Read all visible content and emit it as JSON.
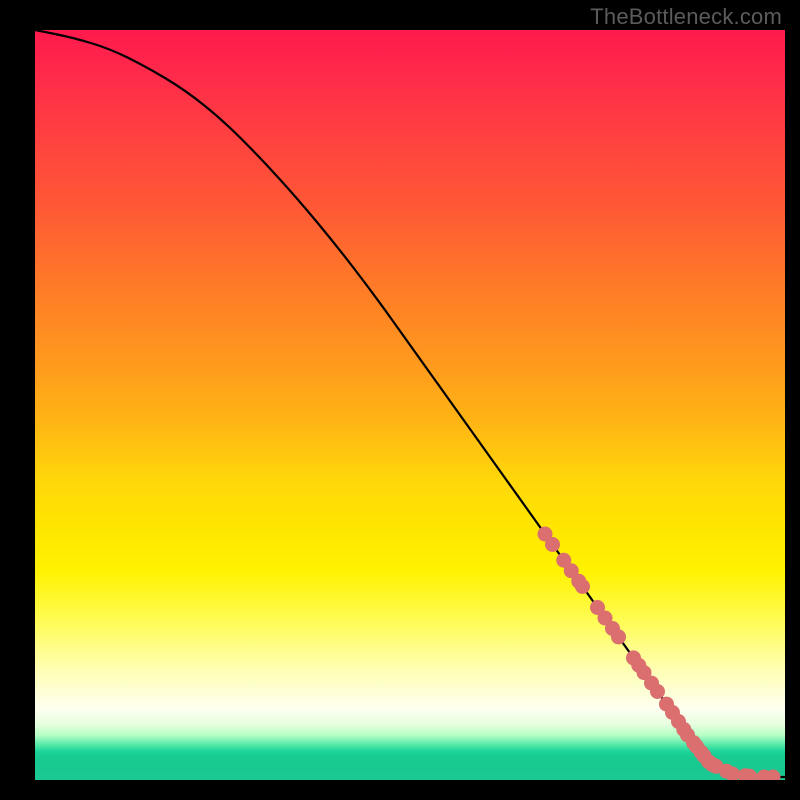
{
  "watermark": "TheBottleneck.com",
  "colors": {
    "page_bg": "#000000",
    "curve_stroke": "#000000",
    "dot_fill": "#db6e6e",
    "watermark_text": "#5b5b5b"
  },
  "chart_data": {
    "type": "line",
    "title": "",
    "xlabel": "",
    "ylabel": "",
    "xlim": [
      0,
      100
    ],
    "ylim": [
      0,
      100
    ],
    "grid": false,
    "legend": false,
    "curve": {
      "x": [
        0,
        5,
        10,
        15,
        20,
        25,
        30,
        35,
        40,
        45,
        50,
        55,
        60,
        65,
        70,
        75,
        80,
        85,
        87,
        90,
        93,
        96,
        100
      ],
      "y": [
        100,
        99,
        97.5,
        95,
        92,
        88,
        83,
        77.5,
        71.5,
        65,
        58,
        51,
        44,
        37,
        30,
        23,
        16,
        9,
        6,
        2.2,
        0.8,
        0.4,
        0.4
      ]
    },
    "points_on_curve": {
      "comment": "Markers lie on the curve near the right end; values approximate positions along x-axis with y derived from curve.",
      "x": [
        68,
        69,
        70.5,
        71.5,
        72.5,
        73,
        75,
        76,
        77,
        77.8,
        79.8,
        80.5,
        81.2,
        82.2,
        83,
        84.2,
        85,
        85.8,
        86.5,
        87,
        87.8,
        88.2,
        88.8,
        89.2,
        89.8,
        90.3,
        90.8,
        92.2,
        93,
        94.7,
        95.3,
        97.2,
        98.4
      ]
    }
  }
}
